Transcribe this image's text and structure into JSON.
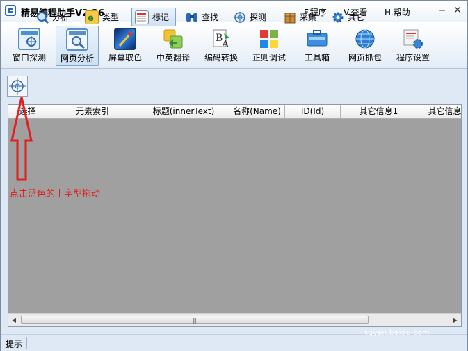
{
  "window": {
    "title": "精易编程助手V2.36",
    "menu": [
      {
        "label": "F.程序"
      },
      {
        "label": "V.查看"
      },
      {
        "label": "H.帮助"
      }
    ],
    "controls": {
      "minimize": "‒",
      "close": "✕"
    }
  },
  "main_toolbar": {
    "items": [
      {
        "label": "窗口探测",
        "icon": "window-probe-icon",
        "active": false
      },
      {
        "label": "网页分析",
        "icon": "webpage-analysis-icon",
        "active": true
      },
      {
        "label": "屏幕取色",
        "icon": "color-picker-icon",
        "active": false
      },
      {
        "label": "中英翻译",
        "icon": "translate-icon",
        "active": false
      },
      {
        "label": "编码转换",
        "icon": "encoding-icon",
        "active": false
      },
      {
        "label": "正则调试",
        "icon": "regex-icon",
        "active": false
      },
      {
        "label": "工具箱",
        "icon": "toolbox-icon",
        "active": false
      },
      {
        "label": "网页抓包",
        "icon": "packet-capture-icon",
        "active": false
      },
      {
        "label": "程序设置",
        "icon": "settings-icon",
        "active": false
      }
    ]
  },
  "sub_toolbar": {
    "crosshair": "crosshair-icon",
    "items": [
      {
        "label": "分析",
        "icon": "analyze-icon",
        "active": false
      },
      {
        "label": "类型",
        "icon": "type-icon",
        "active": false
      },
      {
        "label": "标记",
        "icon": "mark-icon",
        "active": true
      },
      {
        "label": "查找",
        "icon": "binoculars-icon",
        "active": false
      },
      {
        "label": "探测",
        "icon": "probe-icon",
        "active": false
      },
      {
        "label": "采集",
        "icon": "collect-icon",
        "active": false
      },
      {
        "label": "其它",
        "icon": "gear-icon",
        "active": false
      }
    ]
  },
  "table": {
    "columns": [
      "选择",
      "元素索引",
      "标题(innerText)",
      "名称(Name)",
      "ID(Id)",
      "其它信息1",
      "其它信息"
    ],
    "rows": []
  },
  "annotation": {
    "text": "点击蓝色的十字型拖动",
    "color": "#e02020"
  },
  "statusbar": {
    "text": "提示"
  },
  "watermark": "jingyan.baidu.com",
  "colors": {
    "accent": "#2a6ab4",
    "annotation_red": "#e02020",
    "table_bg": "#a0a0a0"
  }
}
